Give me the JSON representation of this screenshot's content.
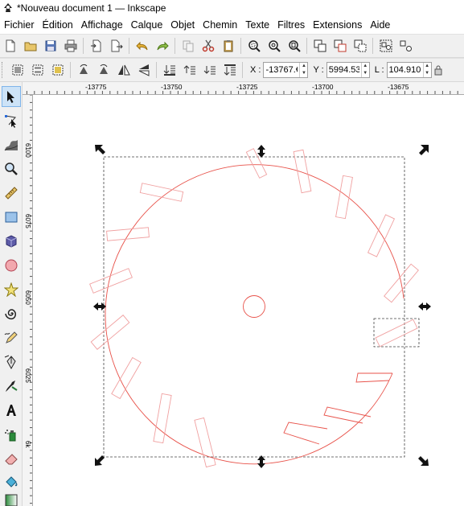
{
  "window": {
    "title": "*Nouveau document 1 — Inkscape"
  },
  "menu": [
    "Fichier",
    "Édition",
    "Affichage",
    "Calque",
    "Objet",
    "Chemin",
    "Texte",
    "Filtres",
    "Extensions",
    "Aide"
  ],
  "coords": {
    "x_label": "X :",
    "x_value": "-13767.€",
    "y_label": "Y :",
    "y_value": "5994.53",
    "w_label": "L :",
    "w_value": "104.910"
  },
  "hruler_labels": [
    "-13775",
    "-13750",
    "-13725",
    "-13700",
    "-13675"
  ],
  "vruler_labels": [
    "6100",
    "6075",
    "6050",
    "6025",
    "6k"
  ],
  "icons": {
    "toolbar1": [
      "new-document-icon",
      "open-icon",
      "save-icon",
      "print-icon",
      "import-icon",
      "export-icon",
      "undo-icon",
      "redo-icon",
      "copy-icon",
      "cut-icon",
      "paste-icon",
      "zoom-selection-icon",
      "zoom-drawing-icon",
      "zoom-page-icon",
      "duplicate-icon",
      "clone-icon",
      "unlink-clone-icon",
      "group-icon",
      "ungroup-icon"
    ],
    "toolbar2": [
      "select-all-icon",
      "select-all-layers-icon",
      "deselect-icon",
      "rotate-ccw-icon",
      "rotate-cw-icon",
      "flip-horizontal-icon",
      "flip-vertical-icon",
      "raise-to-top-icon",
      "raise-icon",
      "lower-icon",
      "lower-to-bottom-icon"
    ],
    "tools": [
      "selector-tool-icon",
      "node-tool-icon",
      "tweak-tool-icon",
      "zoom-tool-icon",
      "measure-tool-icon",
      "rectangle-tool-icon",
      "box3d-tool-icon",
      "ellipse-tool-icon",
      "star-tool-icon",
      "spiral-tool-icon",
      "pencil-tool-icon",
      "pen-tool-icon",
      "calligraphy-tool-icon",
      "text-tool-icon",
      "spray-tool-icon",
      "eraser-tool-icon",
      "paint-bucket-tool-icon",
      "gradient-tool-icon"
    ]
  },
  "colors": {
    "shape_stroke": "#e8524a",
    "selection_dash": "#444444",
    "toolbar_bg": "#f0f0f0"
  }
}
